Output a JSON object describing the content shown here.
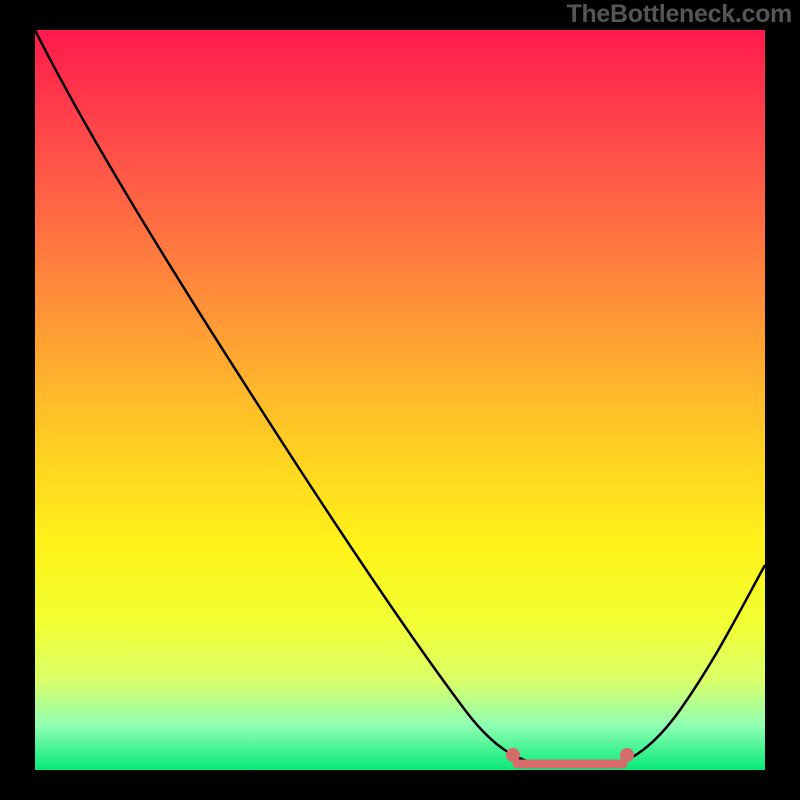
{
  "watermark": "TheBottleneck.com",
  "chart_data": {
    "type": "line",
    "title": "",
    "xlabel": "",
    "ylabel": "",
    "xlim": [
      0,
      100
    ],
    "ylim": [
      0,
      100
    ],
    "series": [
      {
        "name": "bottleneck-curve",
        "x": [
          0,
          10,
          20,
          30,
          40,
          50,
          60,
          65,
          67,
          70,
          78,
          80,
          82,
          86,
          90,
          95,
          100
        ],
        "values": [
          100,
          85,
          70,
          55,
          40,
          25,
          10,
          3,
          1,
          0,
          0,
          1,
          3,
          9,
          15,
          22,
          30
        ]
      }
    ],
    "highlight_range": {
      "x_start": 65,
      "x_end": 80,
      "y": 0
    },
    "background_gradient": {
      "top": "#ff1a4d",
      "mid": "#fff31a",
      "bottom": "#06ea76"
    }
  }
}
